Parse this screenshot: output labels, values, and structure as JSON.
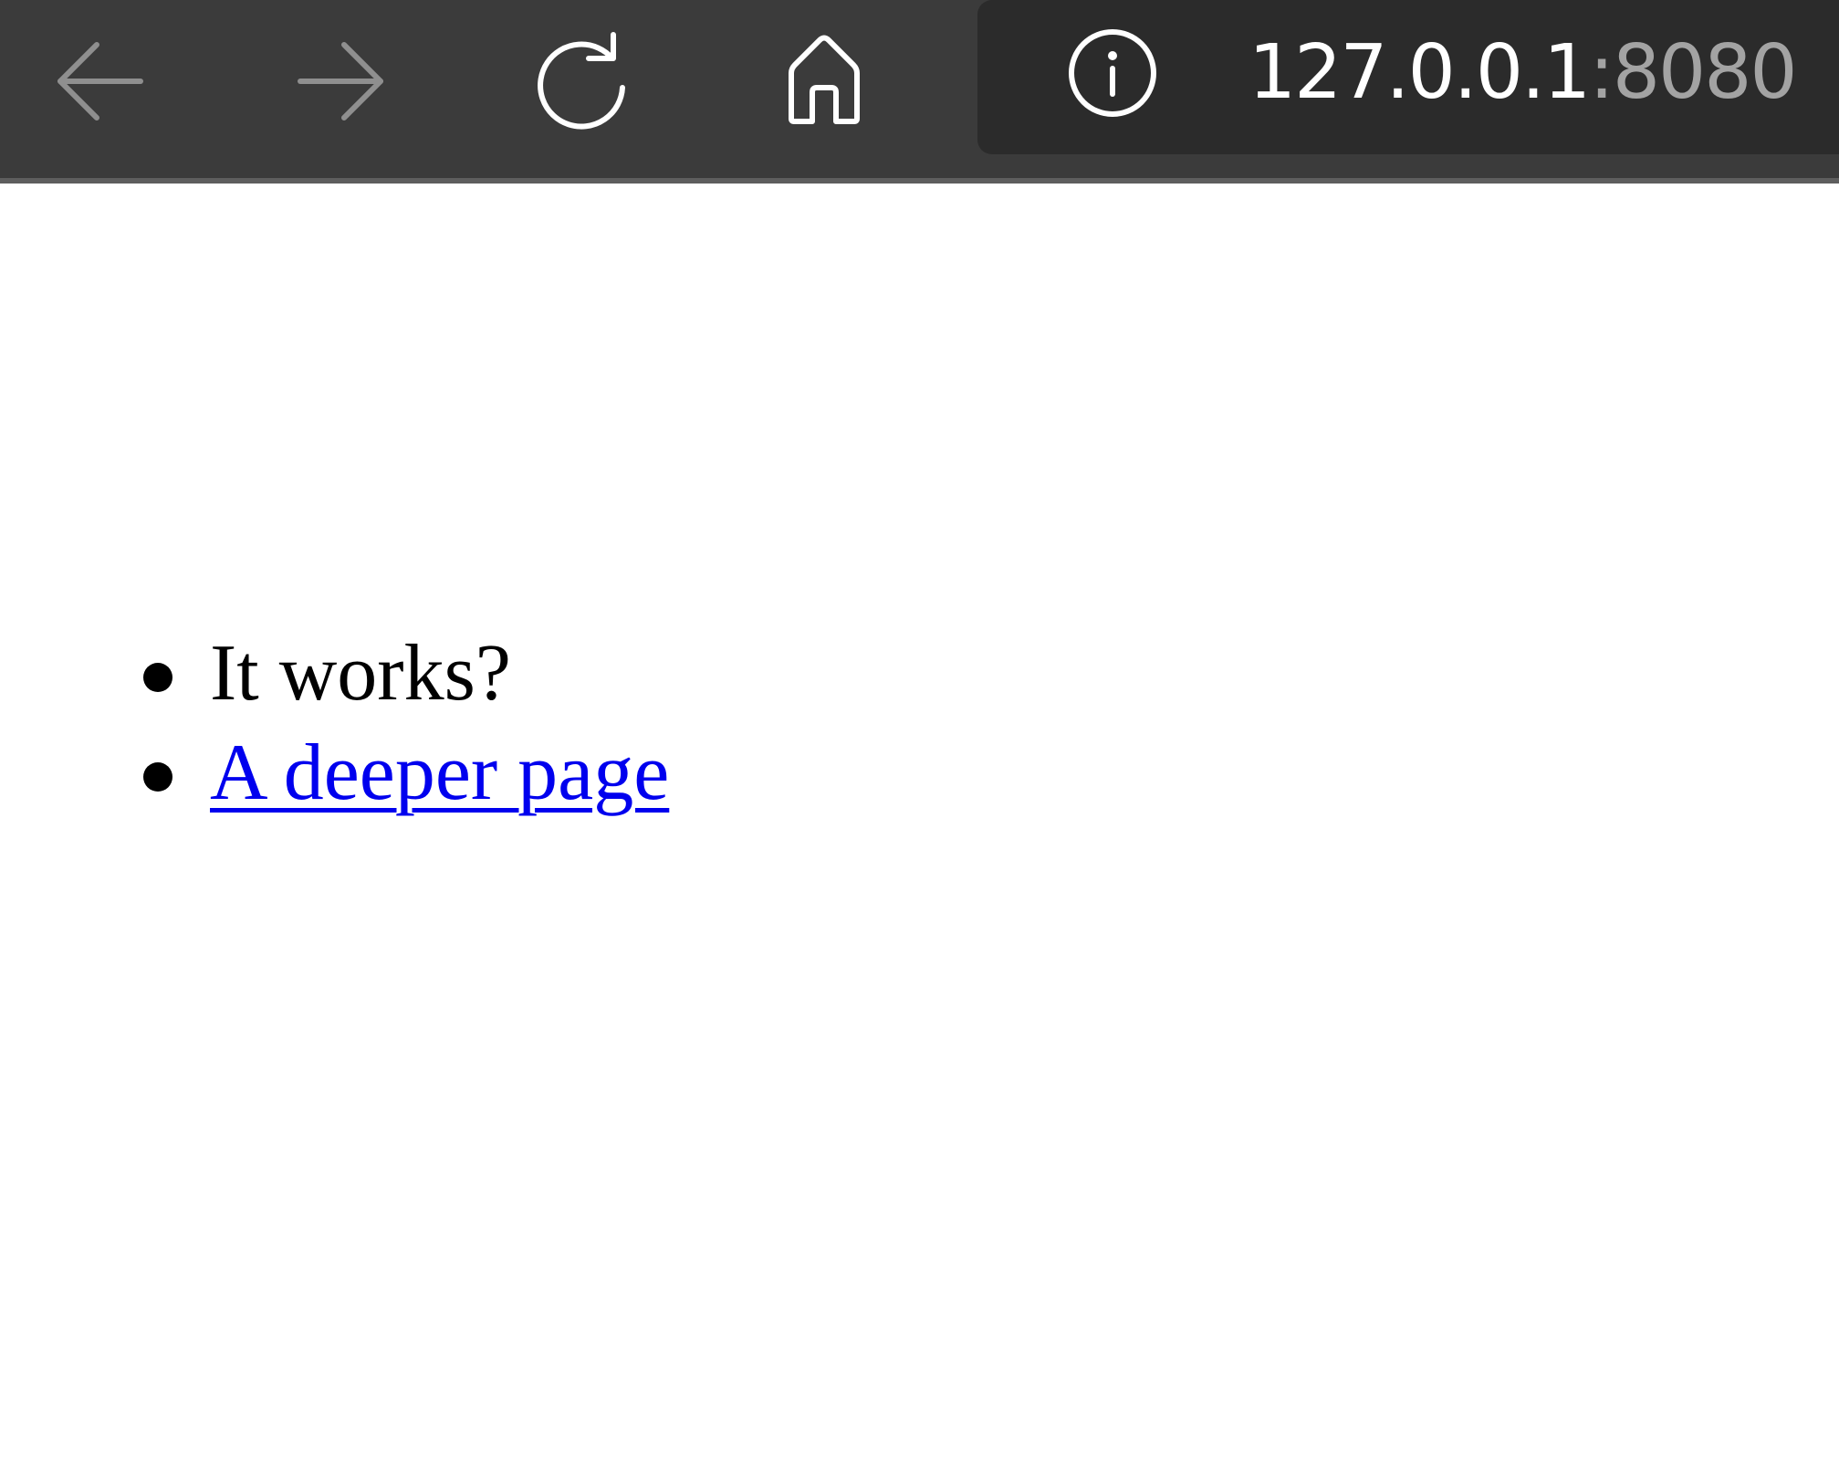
{
  "browser": {
    "toolbar": {
      "back_icon": "arrow-left-icon",
      "forward_icon": "arrow-right-icon",
      "reload_icon": "reload-icon",
      "home_icon": "home-icon"
    },
    "address_bar": {
      "info_icon": "info-circle-icon",
      "host": "127.0.0.1",
      "port": ":8080"
    },
    "colors": {
      "toolbar_bg": "#3b3b3b",
      "address_bar_bg": "#2b2b2b",
      "disabled_icon": "#8f8f8f",
      "enabled_icon": "#ffffff",
      "link": "#0000ee"
    }
  },
  "page": {
    "items": [
      {
        "text": "It works?",
        "is_link": false
      },
      {
        "text": "A deeper page",
        "is_link": true
      }
    ]
  }
}
